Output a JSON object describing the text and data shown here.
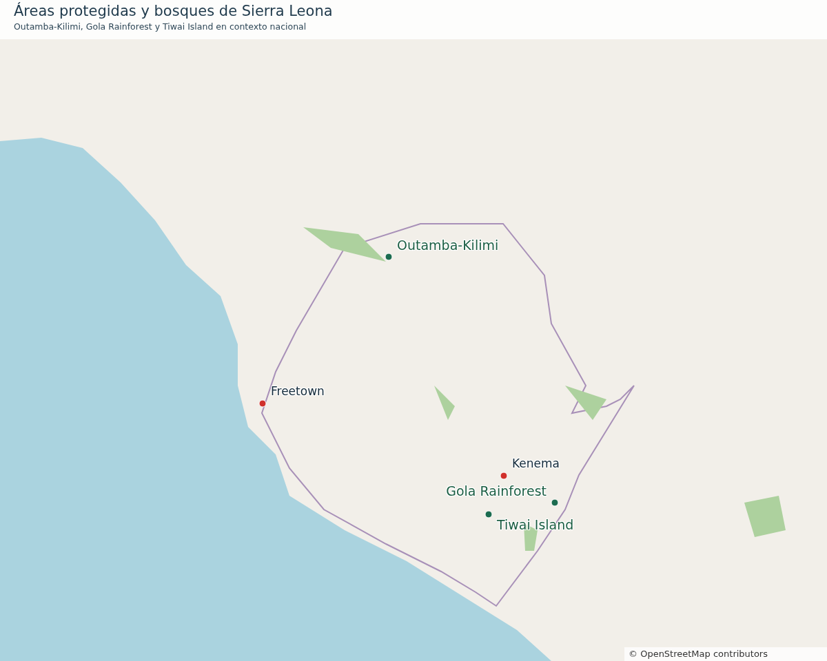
{
  "header": {
    "title": "Áreas protegidas y bosques de Sierra Leona",
    "subtitle": "Outamba-Kilimi, Gola Rainforest y Tiwai Island en contexto nacional"
  },
  "places": [
    {
      "kind": "protected",
      "name": "Outamba-Kilimi",
      "color": "#1b6b4f"
    },
    {
      "kind": "city",
      "name": "Freetown",
      "color": "#d0302b"
    },
    {
      "kind": "city",
      "name": "Kenema",
      "color": "#d0302b"
    },
    {
      "kind": "protected",
      "name": "Gola Rainforest",
      "color": "#1b6b4f"
    },
    {
      "kind": "protected",
      "name": "Tiwai Island",
      "color": "#1b6b4f"
    }
  ],
  "attribution": "© OpenStreetMap contributors"
}
